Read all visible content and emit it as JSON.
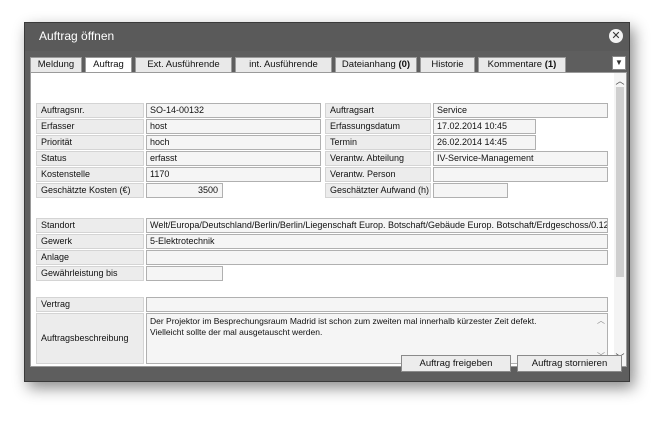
{
  "window": {
    "title": "Auftrag öffnen"
  },
  "tabs": [
    {
      "label": "Meldung",
      "count": ""
    },
    {
      "label": "Auftrag",
      "count": ""
    },
    {
      "label": "Ext. Ausführende",
      "count": ""
    },
    {
      "label": "int. Ausführende",
      "count": ""
    },
    {
      "label": "Dateianhang ",
      "count": "(0)"
    },
    {
      "label": "Historie",
      "count": ""
    },
    {
      "label": "Kommentare ",
      "count": "(1)"
    }
  ],
  "active_tab": "Auftrag",
  "form": {
    "auftragsnr": {
      "label": "Auftragsnr.",
      "value": "SO-14-00132"
    },
    "erfasser": {
      "label": "Erfasser",
      "value": "host"
    },
    "prioritaet": {
      "label": "Priorität",
      "value": "hoch"
    },
    "status": {
      "label": "Status",
      "value": "erfasst"
    },
    "kostenstelle": {
      "label": "Kostenstelle",
      "value": "1170"
    },
    "kosten": {
      "label": "Geschätzte Kosten (€)",
      "value": "3500"
    },
    "auftragsart": {
      "label": "Auftragsart",
      "value": "Service"
    },
    "erfassungsdatum": {
      "label": "Erfassungsdatum",
      "value": "17.02.2014 10:45"
    },
    "termin": {
      "label": "Termin",
      "value": "26.02.2014 14:45"
    },
    "abteilung": {
      "label": "Verantw. Abteilung",
      "value": "IV-Service-Management"
    },
    "person": {
      "label": "Verantw. Person",
      "value": ""
    },
    "aufwand": {
      "label": "Geschätzter Aufwand (h)",
      "value": ""
    },
    "standort": {
      "label": "Standort",
      "value": "Welt/Europa/Deutschland/Berlin/Berlin/Liegenschaft Europ. Botschaft/Gebäude Europ. Botschaft/Erdgeschoss/0.12"
    },
    "gewerk": {
      "label": "Gewerk",
      "value": "5-Elektrotechnik"
    },
    "anlage": {
      "label": "Anlage",
      "value": ""
    },
    "gewaehrleistung": {
      "label": "Gewährleistung bis",
      "value": ""
    },
    "vertrag": {
      "label": "Vertrag",
      "value": ""
    },
    "beschreibung": {
      "label": "Auftragsbeschreibung",
      "line1": "Der Projektor im Besprechungsraum Madrid ist schon zum zweiten mal innerhalb kürzester Zeit defekt.",
      "line2": "Vielleicht sollte der mal ausgetauscht werden."
    }
  },
  "buttons": {
    "freigeben": "Auftrag freigeben",
    "stornieren": "Auftrag stornieren"
  },
  "icons": {
    "close": "close-icon",
    "tab_scroll": "chevron-down-icon",
    "scroll_up": "chevron-up-icon",
    "scroll_down": "chevron-down-icon"
  }
}
